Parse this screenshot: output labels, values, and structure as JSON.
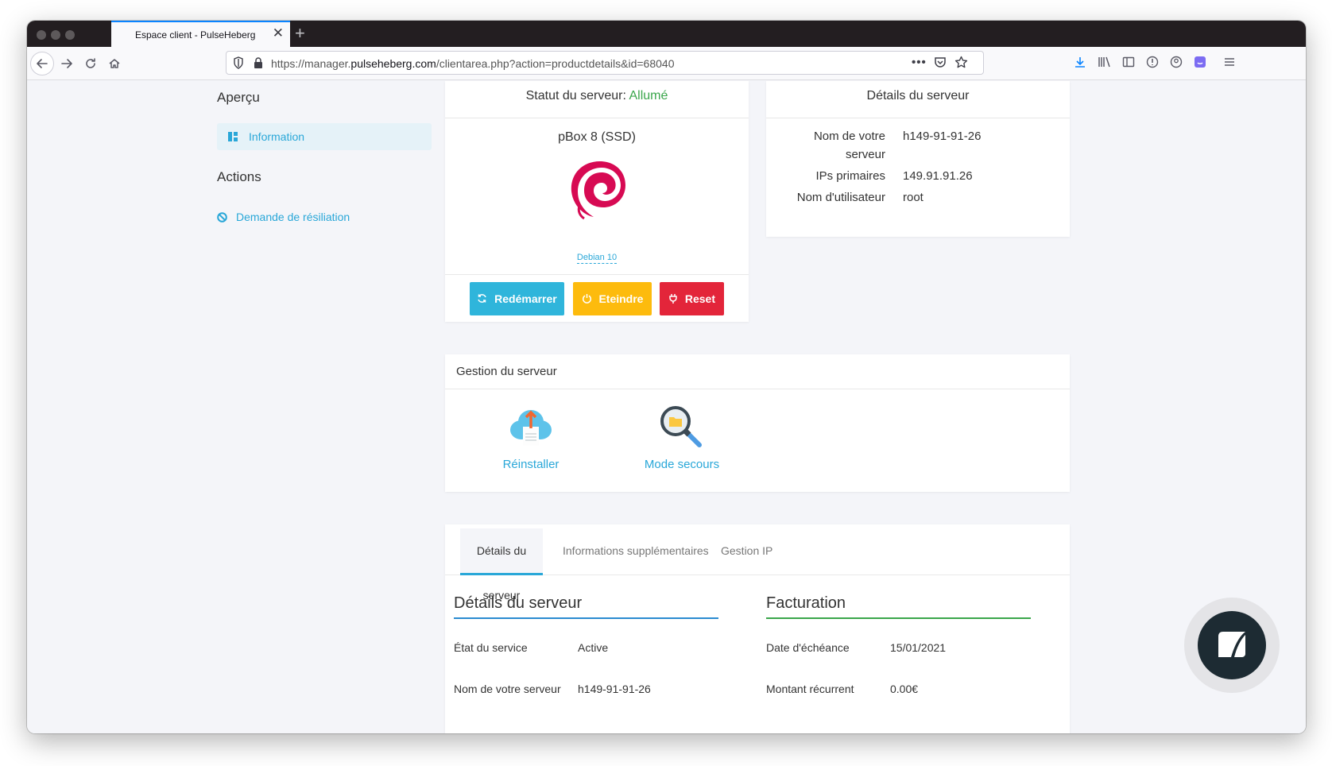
{
  "browser": {
    "tab_title": "Espace client - PulseHeberg",
    "tab_close": "✕",
    "new_tab": "+",
    "url_prefix": "https://manager.",
    "url_host": "pulseheberg.com",
    "url_path": "/clientarea.php?action=productdetails&id=68040"
  },
  "sidebar": {
    "overview_heading": "Aperçu",
    "overview_item": "Information",
    "actions_heading": "Actions",
    "actions_item": "Demande de résiliation"
  },
  "status_card": {
    "label": "Statut du serveur:",
    "value": "Allumé",
    "product": "pBox 8 (SSD)",
    "os": "Debian 10",
    "buttons": {
      "restart": "Redémarrer",
      "shutdown": "Eteindre",
      "reset": "Reset"
    },
    "colors": {
      "restart": "#2fb5db",
      "shutdown": "#fdbb0d",
      "reset": "#e3253a",
      "status_on": "#3aa64b"
    }
  },
  "details_card": {
    "title": "Détails du serveur",
    "rows": [
      {
        "label_line1": "Nom de votre",
        "label_line2": "serveur",
        "value": "h149-91-91-26"
      },
      {
        "label": "IPs primaires",
        "value": "149.91.91.26"
      },
      {
        "label": "Nom d'utilisateur",
        "value": "root"
      }
    ]
  },
  "management": {
    "title": "Gestion du serveur",
    "reinstall": "Réinstaller",
    "rescue": "Mode secours"
  },
  "tabs": {
    "items": [
      "Détails du serveur",
      "Informations supplémentaires",
      "Gestion IP"
    ],
    "active": 0
  },
  "server_details_section": {
    "title": "Détails du serveur",
    "rows": [
      {
        "label": "État du service",
        "value": "Active"
      },
      {
        "label": "Nom de votre serveur",
        "value": "h149-91-91-26"
      }
    ]
  },
  "billing_section": {
    "title": "Facturation",
    "rows": [
      {
        "label": "Date d'échéance",
        "value": "15/01/2021"
      },
      {
        "label": "Montant récurrent",
        "value": "0.00€"
      }
    ]
  }
}
